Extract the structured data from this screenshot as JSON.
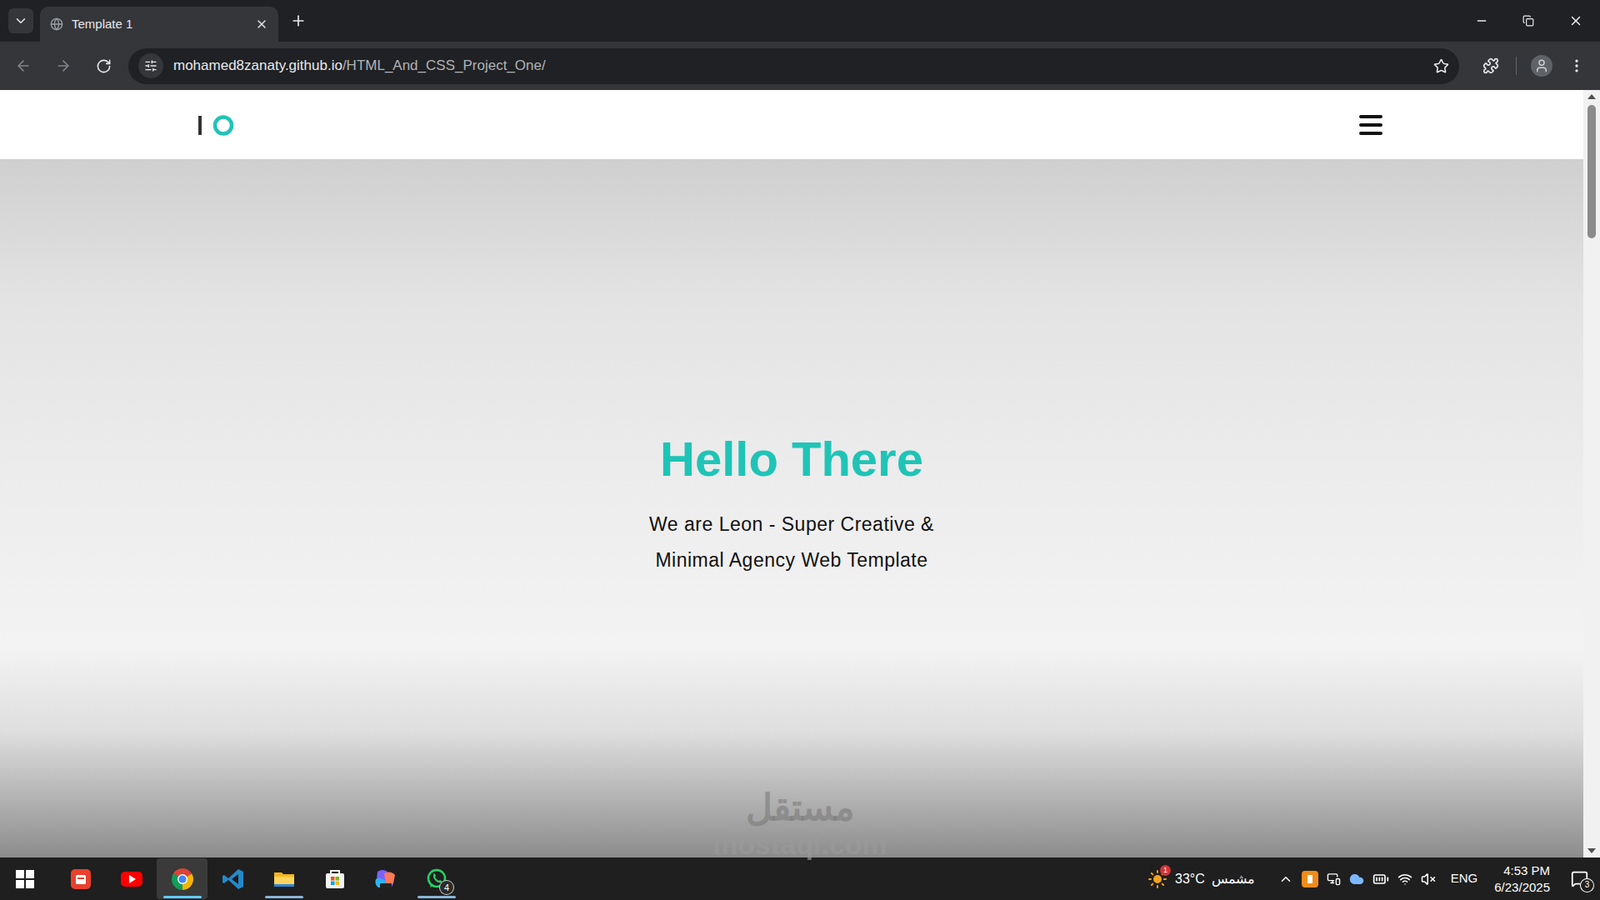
{
  "window": {
    "title": "Template 1"
  },
  "tabs": [
    {
      "label": "Template 1",
      "selected": true
    }
  ],
  "address_bar": {
    "host": "mohamed8zanaty.github.io",
    "path": "/HTML_And_CSS_Project_One/",
    "bookmarked": false
  },
  "page": {
    "header": {
      "menu_open": false
    },
    "hero": {
      "title": "Hello There",
      "subtitle_lines": [
        "We are Leon - Super Creative &",
        "Minimal Agency Web Template"
      ]
    },
    "scrollbar": {
      "level": 0.18
    }
  },
  "watermark": {
    "logo": "مستقل",
    "url": "mostaql.com"
  },
  "taskbar": {
    "apps": [
      {
        "kind": "office",
        "running": false,
        "selected": false,
        "badge": ""
      },
      {
        "kind": "youtube",
        "running": false,
        "selected": false,
        "badge": ""
      },
      {
        "kind": "chrome",
        "running": true,
        "selected": true,
        "badge": ""
      },
      {
        "kind": "vscode",
        "running": false,
        "selected": false,
        "badge": ""
      },
      {
        "kind": "explorer",
        "running": true,
        "selected": false,
        "badge": ""
      },
      {
        "kind": "store",
        "running": false,
        "selected": false,
        "badge": ""
      },
      {
        "kind": "m365",
        "running": false,
        "selected": false,
        "badge": ""
      },
      {
        "kind": "whatsapp",
        "running": true,
        "selected": false,
        "badge": "4"
      }
    ],
    "weather": {
      "temperature": "33°C",
      "condition": "مشمس",
      "badge": "1"
    },
    "language": "ENG",
    "time": "4:53 PM",
    "date": "6/23/2025",
    "notifications": "3"
  }
}
